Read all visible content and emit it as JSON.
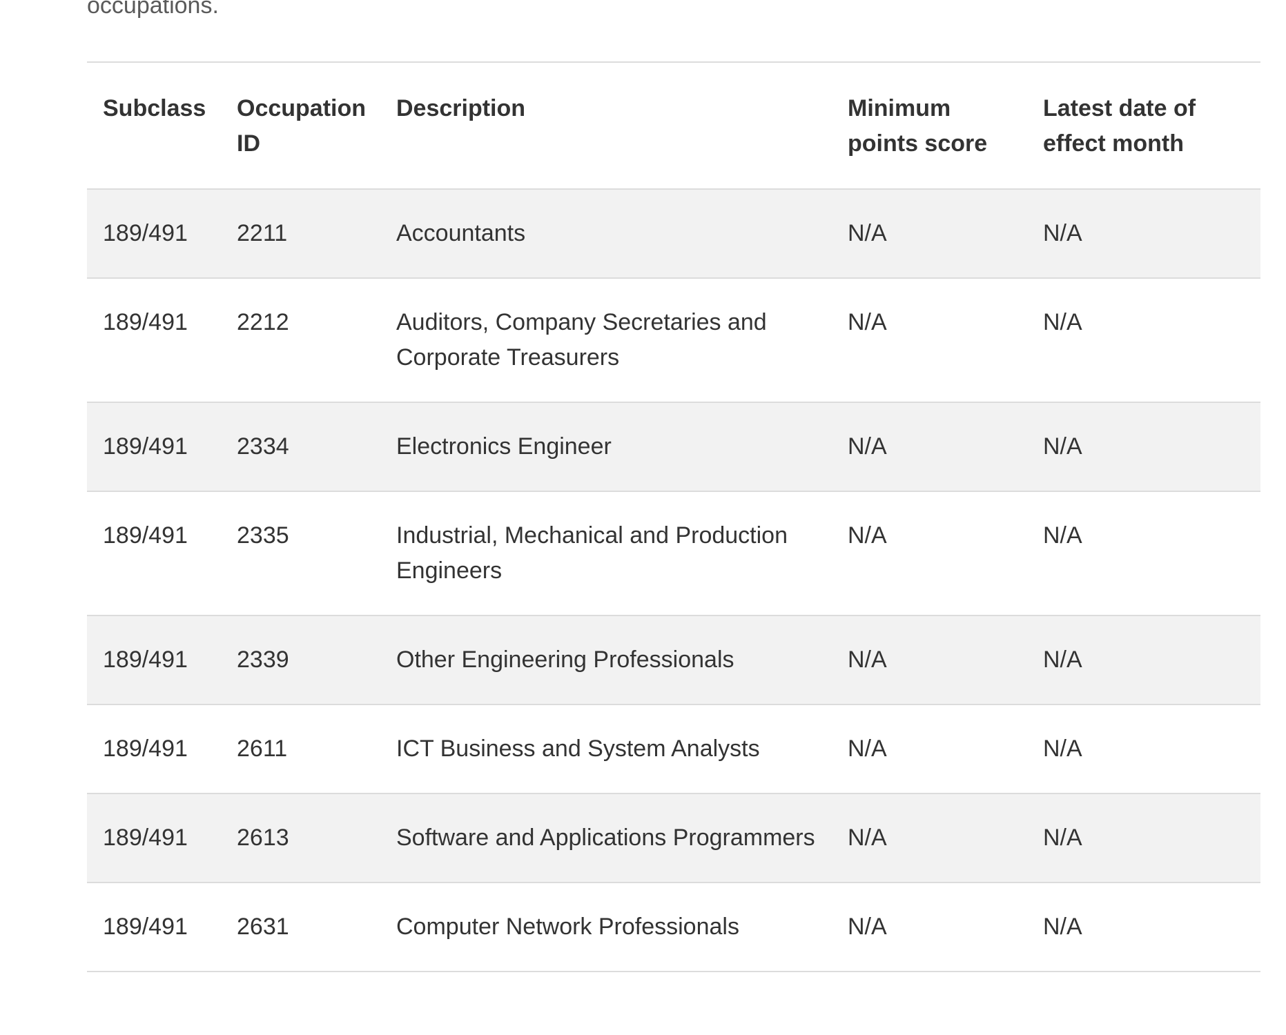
{
  "intro": {
    "text": "occupations."
  },
  "table": {
    "headers": {
      "subclass": "Subclass",
      "occupation_id": "Occupation ID",
      "description": "Description",
      "minimum_points_score": "Minimum points score",
      "latest_date_of_effect_month": "Latest date of effect month"
    },
    "rows": [
      {
        "subclass": "189/491",
        "occupation_id": "2211",
        "description": "Accountants",
        "minimum_points_score": "N/A",
        "latest_date_of_effect_month": "N/A"
      },
      {
        "subclass": "189/491",
        "occupation_id": "2212",
        "description": "Auditors, Company Secretaries and Corporate Treasurers",
        "minimum_points_score": "N/A",
        "latest_date_of_effect_month": "N/A"
      },
      {
        "subclass": "189/491",
        "occupation_id": "2334",
        "description": "Electronics Engineer",
        "minimum_points_score": "N/A",
        "latest_date_of_effect_month": "N/A"
      },
      {
        "subclass": "189/491",
        "occupation_id": "2335",
        "description": "Industrial, Mechanical and Production Engineers",
        "minimum_points_score": "N/A",
        "latest_date_of_effect_month": "N/A"
      },
      {
        "subclass": "189/491",
        "occupation_id": "2339",
        "description": "Other Engineering Professionals",
        "minimum_points_score": "N/A",
        "latest_date_of_effect_month": "N/A"
      },
      {
        "subclass": "189/491",
        "occupation_id": "2611",
        "description": "ICT Business and System Analysts",
        "minimum_points_score": "N/A",
        "latest_date_of_effect_month": "N/A"
      },
      {
        "subclass": "189/491",
        "occupation_id": "2613",
        "description": "Software and Applications Programmers",
        "minimum_points_score": "N/A",
        "latest_date_of_effect_month": "N/A"
      },
      {
        "subclass": "189/491",
        "occupation_id": "2631",
        "description": "Computer Network Professionals",
        "minimum_points_score": "N/A",
        "latest_date_of_effect_month": "N/A"
      }
    ]
  }
}
